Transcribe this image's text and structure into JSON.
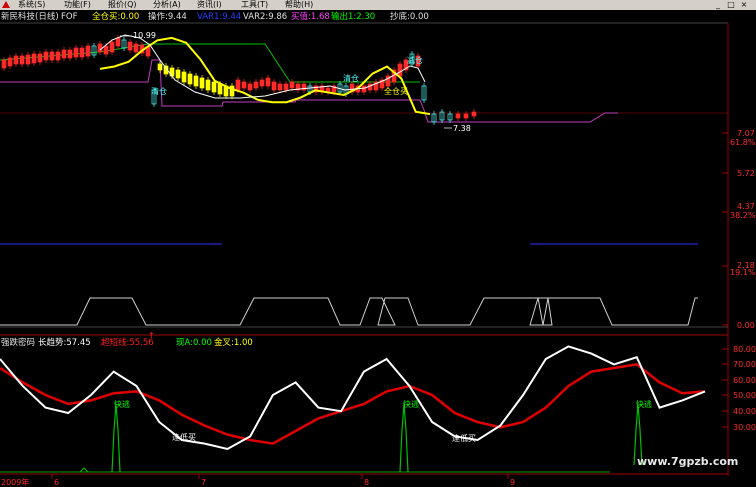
{
  "menu": {
    "items": [
      "系统(S)",
      "功能(F)",
      "报价(Q)",
      "分析(A)",
      "资讯(I)",
      "工具(T)",
      "帮助(H)"
    ],
    "window_buttons": [
      "_",
      "□",
      "×"
    ]
  },
  "header": {
    "stock": "新民科技(日线)",
    "formula": "FOF",
    "f1": "全仓买:0.00",
    "f2": "操作:9.44",
    "f3": "VAR1:9.44",
    "f4": "VAR2:9.86",
    "f5": "买值:1.68",
    "f6": "输出1:2.30",
    "f7": "抄底:0.00"
  },
  "lower_header": {
    "name": "强跌密码",
    "f1": "长趋势:57.45",
    "f2": "超短线:55.56",
    "f3": "现A:0.00",
    "f4": "金叉:1.00"
  },
  "annotations": {
    "high": "10.99",
    "low": "7.38",
    "qingcang1": "清仓",
    "qingcang2": "清仓",
    "jianchang": "减仓",
    "quancangmai": "全仓买",
    "kuaitao1": "快逃",
    "kuaitao2": "快逃",
    "kuaitao3": "快逃",
    "dixi1": "逢低买",
    "dixi2": "逢低买"
  },
  "right_axis_upper": [
    "7.07",
    "61.8%",
    "5.72",
    "4.37",
    "38.2%",
    "2.18",
    "19.1%",
    "0.00"
  ],
  "right_axis_lower": [
    "80.00",
    "70.00",
    "60.00",
    "50.00",
    "40.00",
    "30.00"
  ],
  "date_axis": [
    "2009年",
    "6",
    "7",
    "8",
    "9"
  ],
  "watermark": "www.7gpzb.com",
  "colors": {
    "up": "#ff2a2a",
    "down": "#54fcfc",
    "yellow": "#ffff00",
    "purple": "#c040c0",
    "green": "#00c000",
    "blue": "#3030ff",
    "white": "#ffffff",
    "red": "#ff0000"
  },
  "chart_data": [
    {
      "type": "line",
      "title": "新民科技(日线)",
      "series": [
        {
          "name": "操作",
          "values": [
            9.4,
            9.5,
            9.7,
            10.2,
            10.6,
            10.7,
            10.5,
            9.8,
            8.9,
            8.6,
            8.4,
            8.1,
            8.0,
            8.0,
            8.2,
            8.5,
            8.4,
            8.3,
            8.6,
            9.2,
            9.5,
            9.0,
            7.6,
            7.5
          ]
        }
      ],
      "x": [
        1,
        2,
        3,
        4,
        5,
        6,
        7,
        8,
        9,
        10,
        11,
        12,
        13,
        14,
        15,
        16,
        17,
        18,
        19,
        20,
        21,
        22,
        23,
        24
      ],
      "ylim": [
        7.0,
        11.2
      ]
    },
    {
      "type": "line",
      "series": [
        {
          "name": "长趋势",
          "values": [
            70,
            62,
            55,
            50,
            52,
            56,
            57,
            52,
            44,
            38,
            33,
            30,
            28,
            35,
            42,
            46,
            50,
            57,
            60,
            55,
            45,
            40,
            37,
            40,
            48,
            60,
            68,
            70,
            72,
            62,
            56,
            57
          ]
        },
        {
          "name": "超短线",
          "values": [
            75,
            60,
            48,
            45,
            55,
            68,
            60,
            40,
            30,
            28,
            25,
            32,
            55,
            62,
            48,
            46,
            68,
            75,
            60,
            40,
            32,
            30,
            38,
            55,
            75,
            82,
            78,
            72,
            76,
            48,
            52,
            57
          ]
        }
      ],
      "x": [
        1,
        2,
        3,
        4,
        5,
        6,
        7,
        8,
        9,
        10,
        11,
        12,
        13,
        14,
        15,
        16,
        17,
        18,
        19,
        20,
        21,
        22,
        23,
        24,
        25,
        26,
        27,
        28,
        29,
        30,
        31,
        32
      ],
      "ylim": [
        20,
        85
      ]
    }
  ]
}
